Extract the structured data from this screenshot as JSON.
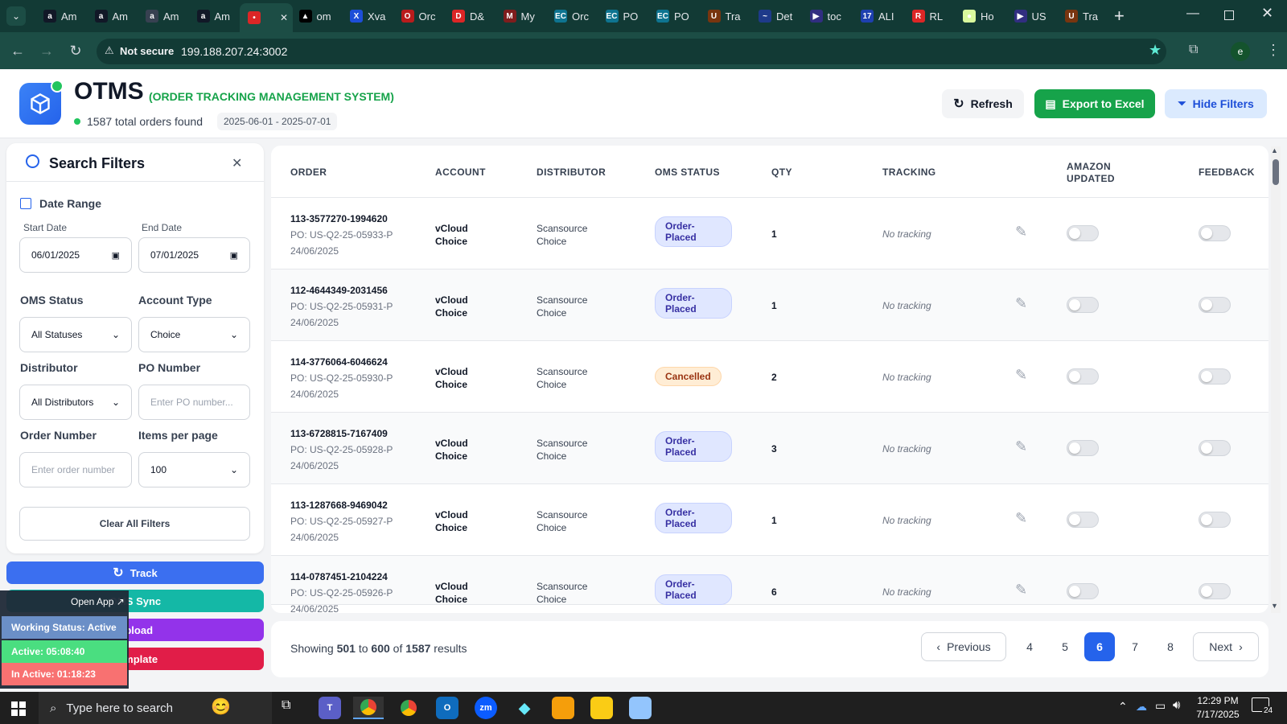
{
  "browser": {
    "tabs": [
      {
        "label": "Am",
        "icon": "amazon-icon",
        "color": "#111827",
        "glyph": "a"
      },
      {
        "label": "Am",
        "icon": "amazon-icon",
        "color": "#111827",
        "glyph": "a"
      },
      {
        "label": "Am",
        "icon": "amazon-icon",
        "color": "#374151",
        "glyph": "a"
      },
      {
        "label": "Am",
        "icon": "amazon-icon",
        "color": "#111827",
        "glyph": "a"
      },
      {
        "label": "",
        "icon": "app-icon",
        "color": "#dc2626",
        "glyph": "•"
      },
      {
        "label": "om",
        "icon": "triangle-icon",
        "color": "#000000",
        "glyph": "▲"
      },
      {
        "label": "Xva",
        "icon": "xva-icon",
        "color": "#1d4ed8",
        "glyph": "X"
      },
      {
        "label": "Orc",
        "icon": "orc-icon",
        "color": "#b91c1c",
        "glyph": "O"
      },
      {
        "label": "D&",
        "icon": "dh-icon",
        "color": "#dc2626",
        "glyph": "D"
      },
      {
        "label": "My",
        "icon": "my-icon",
        "color": "#7f1d1d",
        "glyph": "M"
      },
      {
        "label": "Orc",
        "icon": "ec-icon",
        "color": "#0e7490",
        "glyph": "EC"
      },
      {
        "label": "PO",
        "icon": "ec-icon",
        "color": "#0e7490",
        "glyph": "EC"
      },
      {
        "label": "PO",
        "icon": "ec-icon",
        "color": "#0e7490",
        "glyph": "EC"
      },
      {
        "label": "Tra",
        "icon": "ups-icon",
        "color": "#78350f",
        "glyph": "U"
      },
      {
        "label": "Det",
        "icon": "usps-icon",
        "color": "#1e3a8a",
        "glyph": "~"
      },
      {
        "label": "toc",
        "icon": "mail-icon",
        "color": "#312e81",
        "glyph": "▶"
      },
      {
        "label": "ALI",
        "icon": "ali-icon",
        "color": "#1e40af",
        "glyph": "17"
      },
      {
        "label": "RL",
        "icon": "rl-icon",
        "color": "#dc2626",
        "glyph": "R"
      },
      {
        "label": "Ho",
        "icon": "ho-icon",
        "color": "#d9f99d",
        "glyph": "●"
      },
      {
        "label": "US",
        "icon": "usps-icon",
        "color": "#312e81",
        "glyph": "▶"
      },
      {
        "label": "Tra",
        "icon": "ups-icon",
        "color": "#78350f",
        "glyph": "U"
      }
    ],
    "security": "Not secure",
    "url": "199.188.207.24:3002",
    "profile": "e"
  },
  "header": {
    "title": "OTMS",
    "subtitle": "(ORDER TRACKING MANAGEMENT SYSTEM)",
    "total": "1587 total orders found",
    "date_range": "2025-06-01 - 2025-07-01",
    "refresh": "Refresh",
    "export": "Export to Excel",
    "hide_filters": "Hide Filters"
  },
  "filters": {
    "title": "Search Filters",
    "date_range": "Date Range",
    "start_label": "Start Date",
    "start_value": "06/01/2025",
    "end_label": "End Date",
    "end_value": "07/01/2025",
    "oms_status": "OMS Status",
    "oms_status_value": "All Statuses",
    "account_type": "Account Type",
    "account_type_value": "Choice",
    "distributor": "Distributor",
    "distributor_value": "All Distributors",
    "po_number": "PO Number",
    "po_placeholder": "Enter PO number...",
    "order_number": "Order Number",
    "order_placeholder": "Enter order number",
    "items_per_page": "Items per page",
    "items_per_page_value": "100",
    "clear": "Clear All Filters"
  },
  "actions": {
    "track": "Track",
    "oms_sync": "OMS Sync",
    "upload": "Upload",
    "template": "Template"
  },
  "widget": {
    "open_app": "Open App",
    "working_status": "Working Status: Active",
    "active": "Active: 05:08:40",
    "inactive": "In Active: 01:18:23"
  },
  "table": {
    "headers": {
      "order": "ORDER",
      "account": "ACCOUNT",
      "distributor": "DISTRIBUTOR",
      "oms_status": "OMS STATUS",
      "qty": "QTY",
      "tracking": "TRACKING",
      "amazon_updated_1": "AMAZON",
      "amazon_updated_2": "UPDATED",
      "feedback": "FEEDBACK"
    },
    "rows": [
      {
        "order": "113-3577270-1994620",
        "po": "PO: US-Q2-25-05933-P",
        "date": "24/06/2025",
        "acc1": "vCloud",
        "acc2": "Choice",
        "dist1": "Scansource",
        "dist2": "Choice",
        "st1": "Order-",
        "st2": "Placed",
        "qty": "1",
        "tracking": "No tracking"
      },
      {
        "order": "112-4644349-2031456",
        "po": "PO: US-Q2-25-05931-P",
        "date": "24/06/2025",
        "acc1": "vCloud",
        "acc2": "Choice",
        "dist1": "Scansource",
        "dist2": "Choice",
        "st1": "Order-",
        "st2": "Placed",
        "qty": "1",
        "tracking": "No tracking"
      },
      {
        "order": "114-3776064-6046624",
        "po": "PO: US-Q2-25-05930-P",
        "date": "24/06/2025",
        "acc1": "vCloud",
        "acc2": "Choice",
        "dist1": "Scansource",
        "dist2": "Choice",
        "st1": "Cancelled",
        "st2": "",
        "qty": "2",
        "tracking": "No tracking"
      },
      {
        "order": "113-6728815-7167409",
        "po": "PO: US-Q2-25-05928-P",
        "date": "24/06/2025",
        "acc1": "vCloud",
        "acc2": "Choice",
        "dist1": "Scansource",
        "dist2": "Choice",
        "st1": "Order-",
        "st2": "Placed",
        "qty": "3",
        "tracking": "No tracking"
      },
      {
        "order": "113-1287668-9469042",
        "po": "PO: US-Q2-25-05927-P",
        "date": "24/06/2025",
        "acc1": "vCloud",
        "acc2": "Choice",
        "dist1": "Scansource",
        "dist2": "Choice",
        "st1": "Order-",
        "st2": "Placed",
        "qty": "1",
        "tracking": "No tracking"
      },
      {
        "order": "114-0787451-2104224",
        "po": "PO: US-Q2-25-05926-P",
        "date": "24/06/2025",
        "acc1": "vCloud",
        "acc2": "Choice",
        "dist1": "Scansource",
        "dist2": "Choice",
        "st1": "Order-",
        "st2": "Placed",
        "qty": "6",
        "tracking": "No tracking"
      }
    ]
  },
  "pagination": {
    "showing": "Showing",
    "from": "501",
    "to_word": "to",
    "to": "600",
    "of_word": "of",
    "total": "1587",
    "results": "results",
    "previous": "Previous",
    "pages": [
      "4",
      "5",
      "6",
      "7",
      "8"
    ],
    "current": "6",
    "next": "Next"
  },
  "taskbar": {
    "search_placeholder": "Type here to search",
    "time": "12:29 PM",
    "date": "7/17/2025",
    "notifications": "24"
  },
  "colors": {
    "accent": "#2563eb",
    "export": "#16a34a",
    "track": "#3b6ff0",
    "oms_sync": "#14b8a6",
    "upload": "#9333ea",
    "template": "#e11d48"
  }
}
